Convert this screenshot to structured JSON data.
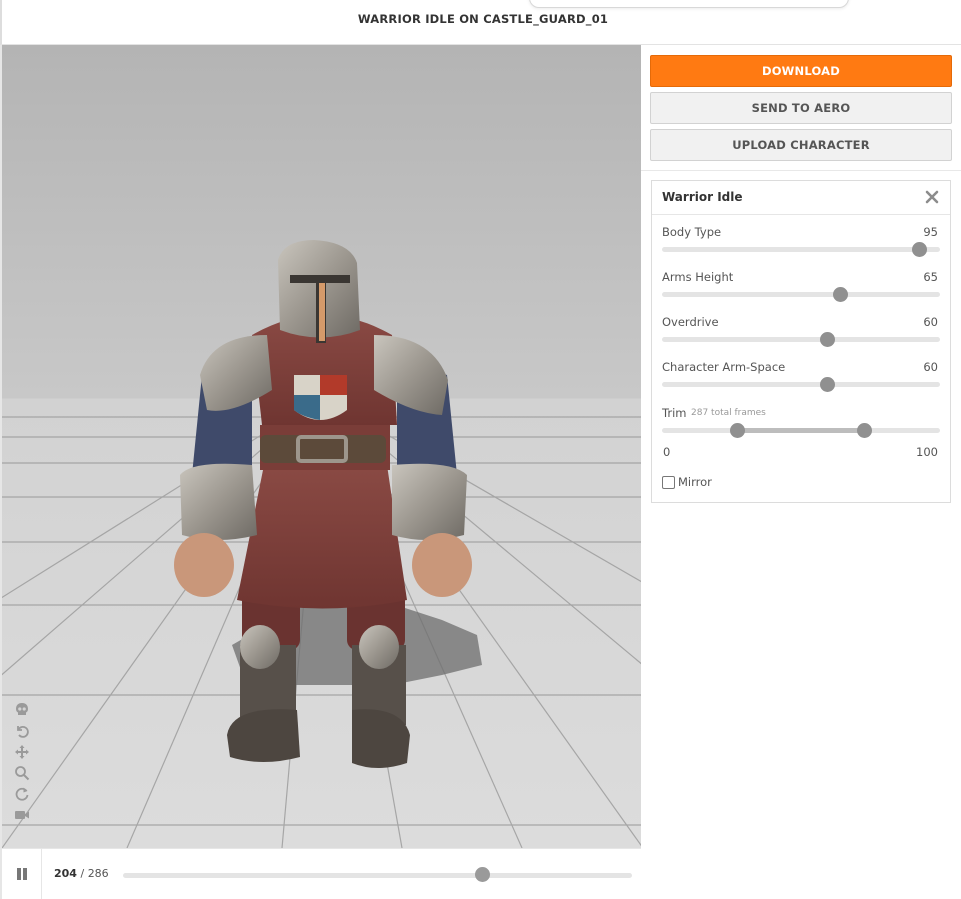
{
  "header": {
    "title": "WARRIOR IDLE ON CASTLE_GUARD_01"
  },
  "viewport": {
    "character": "knight-warrior-model",
    "tools": [
      "skull-icon",
      "undo-icon",
      "move-icon",
      "zoom-icon",
      "rotate-icon",
      "camera-icon"
    ]
  },
  "timeline": {
    "current_frame": "204",
    "separator": "/",
    "total_frames": "286",
    "progress": 0.713
  },
  "actions": {
    "download_label": "DOWNLOAD",
    "aero_label": "SEND TO AERO",
    "upload_label": "UPLOAD CHARACTER"
  },
  "panel": {
    "title": "Warrior Idle",
    "params": [
      {
        "label": "Body Type",
        "value": "95",
        "fraction": 0.95
      },
      {
        "label": "Arms Height",
        "value": "65",
        "fraction": 0.65
      },
      {
        "label": "Overdrive",
        "value": "60",
        "fraction": 0.6
      },
      {
        "label": "Character Arm-Space",
        "value": "60",
        "fraction": 0.6
      }
    ],
    "trim": {
      "label": "Trim",
      "frames_note": "287 total frames",
      "min_label": "0",
      "max_label": "100",
      "start": 0.26,
      "end": 0.74
    },
    "mirror": {
      "label": "Mirror",
      "checked": false
    }
  },
  "colors": {
    "accent": "#ff7a12",
    "thumb": "#909090"
  }
}
